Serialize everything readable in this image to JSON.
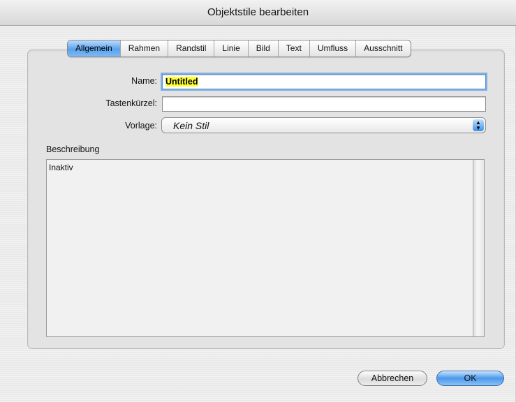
{
  "window": {
    "title": "Objektstile bearbeiten"
  },
  "tabs": [
    "Allgemein",
    "Rahmen",
    "Randstil",
    "Linie",
    "Bild",
    "Text",
    "Umfluss",
    "Ausschnitt"
  ],
  "active_tab": "Allgemein",
  "form": {
    "name_label": "Name:",
    "name_value": "Untitled",
    "shortcut_label": "Tastenkürzel:",
    "shortcut_value": "",
    "template_label": "Vorlage:",
    "template_value": "Kein Stil",
    "description_label": "Beschreibung",
    "description_value": "Inaktiv"
  },
  "buttons": {
    "cancel": "Abbrechen",
    "ok": "OK"
  },
  "icons": {
    "popup_arrows": "updown-arrows-icon"
  }
}
